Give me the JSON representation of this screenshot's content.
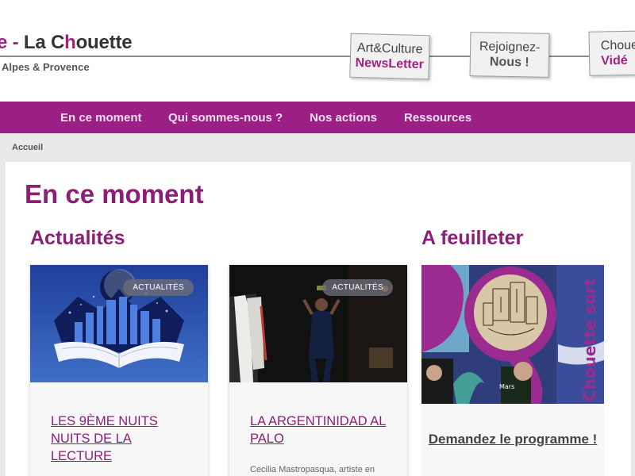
{
  "header": {
    "logo_prefix": "e - ",
    "logo_name_a": "La C",
    "logo_name_b": "h",
    "logo_name_c": "ou",
    "logo_name_d": "ette",
    "logo_subtitle": "Alpes & Provence",
    "stamps": [
      {
        "line1": "Art&Culture",
        "line2": "NewsLetter"
      },
      {
        "line1": "Rejoignez-",
        "line2": "Nous !"
      },
      {
        "line1": "Choue",
        "line2": "Vidé"
      }
    ]
  },
  "nav": {
    "items": [
      "En ce moment",
      "Qui sommes-nous ?",
      "Nos actions",
      "Ressources"
    ]
  },
  "breadcrumb": "Accueil",
  "main": {
    "page_title": "En ce moment",
    "news_title": "Actualités",
    "magazine_title": "A feuilleter",
    "cards": [
      {
        "badge": "ACTUALITÉS",
        "title": "LES 9ÈME NUITS NUITS DE LA LECTURE",
        "excerpt": ""
      },
      {
        "badge": "ACTUALITÉS",
        "title": "LA ARGENTINIDAD AL PALO",
        "excerpt": "Cecilia Mastropasqua, artiste en"
      }
    ],
    "magazine": {
      "cover_vertical_text": "Chouette sort",
      "cover_date_text": "Mars",
      "link": "Demandez le programme !"
    }
  },
  "colors": {
    "brand_purple": "#9c1f86",
    "title_purple": "#8d1e78"
  }
}
